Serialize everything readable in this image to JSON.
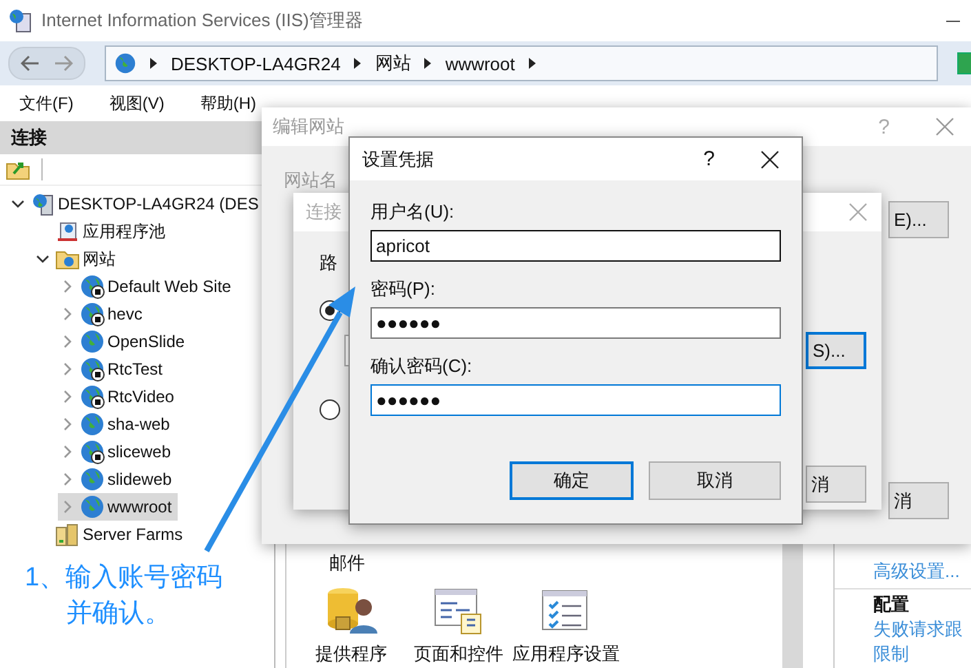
{
  "window": {
    "title": "Internet Information Services (IIS)管理器"
  },
  "address_bar": {
    "crumbs": [
      "DESKTOP-LA4GR24",
      "网站",
      "wwwroot"
    ]
  },
  "menu": [
    "文件(F)",
    "视图(V)",
    "帮助(H)"
  ],
  "connections": {
    "title": "连接",
    "tree": [
      {
        "label": "DESKTOP-LA4GR24 (DES",
        "kind": "server",
        "expanded": true,
        "selected": false,
        "children": [
          {
            "label": "应用程序池",
            "kind": "pool",
            "selected": false
          },
          {
            "label": "网站",
            "kind": "sites",
            "expanded": true,
            "selected": false,
            "children": [
              {
                "label": "Default Web Site",
                "kind": "site",
                "stopped": true,
                "expanded": false,
                "selected": false
              },
              {
                "label": "hevc",
                "kind": "site",
                "stopped": true,
                "expanded": false,
                "selected": false
              },
              {
                "label": "OpenSlide",
                "kind": "site",
                "stopped": false,
                "expanded": false,
                "selected": false
              },
              {
                "label": "RtcTest",
                "kind": "site",
                "stopped": true,
                "expanded": false,
                "selected": false
              },
              {
                "label": "RtcVideo",
                "kind": "site",
                "stopped": true,
                "expanded": false,
                "selected": false
              },
              {
                "label": "sha-web",
                "kind": "site",
                "stopped": false,
                "expanded": false,
                "selected": false
              },
              {
                "label": "sliceweb",
                "kind": "site",
                "stopped": true,
                "expanded": false,
                "selected": false
              },
              {
                "label": "slideweb",
                "kind": "site",
                "stopped": false,
                "expanded": false,
                "selected": false
              },
              {
                "label": "wwwroot",
                "kind": "site",
                "stopped": false,
                "expanded": false,
                "selected": true
              }
            ]
          },
          {
            "label": "Server Farms",
            "kind": "farms",
            "selected": false
          }
        ]
      }
    ]
  },
  "features": {
    "partial_label": "邮件",
    "items": [
      {
        "label": "提供程序",
        "kind": "providers"
      },
      {
        "label": "页面和控件",
        "kind": "pages"
      },
      {
        "label": "应用程序设置",
        "kind": "settings"
      }
    ]
  },
  "actions": [
    {
      "kind": "link",
      "label": "高级设置..."
    },
    {
      "kind": "heading",
      "label": "配置"
    },
    {
      "kind": "link",
      "label": "失败请求跟"
    },
    {
      "kind": "link",
      "label": "限制"
    }
  ],
  "edit_site": {
    "title": "编辑网站",
    "help": "?",
    "site_name_label": "网站名",
    "select_fragment": "E)...",
    "cancel_fragment": "消"
  },
  "connect_as": {
    "title": "连接",
    "path_label": "路",
    "options": [
      {
        "selected": true
      },
      {
        "selected": false
      }
    ],
    "set_fragment": "S)...",
    "cancel_fragment": "消"
  },
  "credentials": {
    "title": "设置凭据",
    "help": "?",
    "fields": [
      {
        "label": "用户名(U):",
        "value": "apricot",
        "hovered": true,
        "focused": false
      },
      {
        "label": "密码(P):",
        "value": "●●●●●●",
        "hovered": false,
        "focused": false
      },
      {
        "label": "确认密码(C):",
        "value": "●●●●●●",
        "hovered": false,
        "focused": true
      }
    ],
    "ok": "确定",
    "cancel": "取消"
  },
  "annotation": {
    "lines": [
      "1、输入账号密码",
      "并确认。"
    ]
  }
}
